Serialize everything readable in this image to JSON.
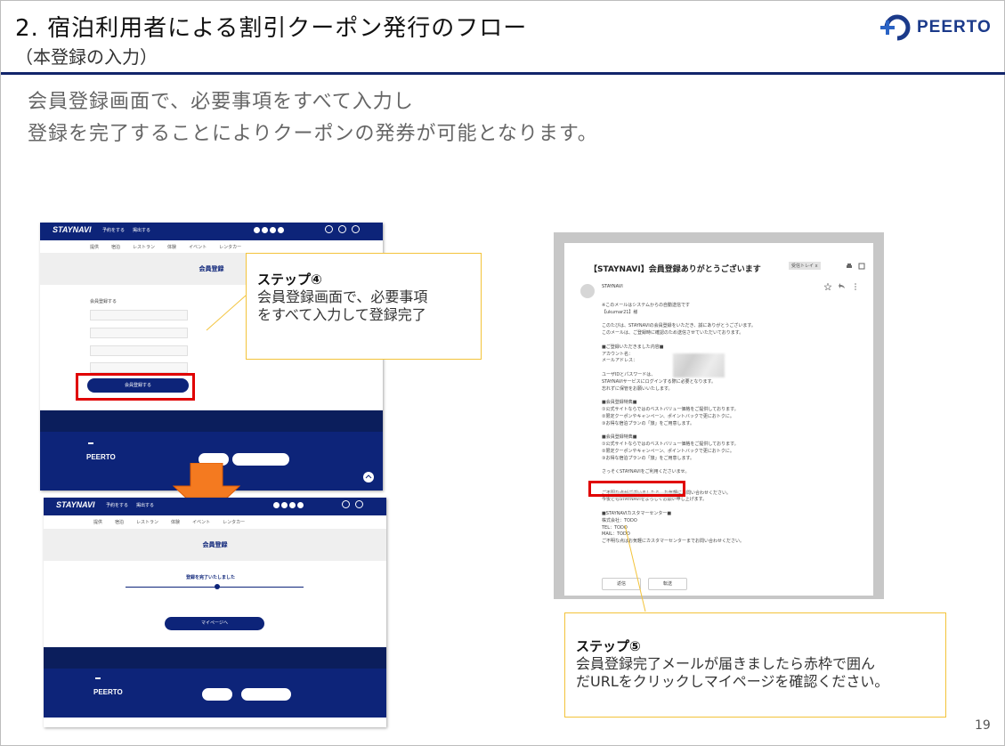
{
  "slide": {
    "title": "2. 宿泊利用者による割引クーポン発行のフロー",
    "subtitle": "（本登録の入力）",
    "brand": "PEERTO",
    "lead_lines": [
      "会員登録画面で、必要事項をすべて入力し",
      "登録を完了することによりクーポンの発券が可能となります。"
    ],
    "page_number": "19",
    "accent_color": "#12256b",
    "highlight_color": "#e00000",
    "callout_border": "#f3c33a"
  },
  "step4": {
    "label": "ステップ④",
    "lines": [
      "会員登録画面で、必要事項",
      "をすべて入力して登録完了"
    ]
  },
  "step5": {
    "label": "ステップ⑤",
    "lines": [
      "会員登録完了メールが届きましたら赤枠で囲ん",
      "だURLをクリックしマイページを確認ください。"
    ]
  },
  "shot1": {
    "logo": "STAYNAVI",
    "header_buttons": [
      "予約をする",
      "掲出する"
    ],
    "nav": [
      "提供",
      "宿泊",
      "レストラン",
      "体験",
      "イベント",
      "レンタカー"
    ],
    "banner": "会員登録",
    "form_heading": "会員登録する",
    "fields": [
      "",
      "",
      "",
      ""
    ],
    "submit": "会員登録する",
    "footer_logo": "PEERTO"
  },
  "shot2": {
    "logo": "STAYNAVI",
    "header_buttons": [
      "予約をする",
      "掲出する"
    ],
    "nav": [
      "提供",
      "宿泊",
      "レストラン",
      "体験",
      "イベント",
      "レンタカー"
    ],
    "banner": "会員登録",
    "done_heading": "登録を完了いたしました",
    "mypage": "マイページへ",
    "footer_logo": "PEERTO"
  },
  "email": {
    "subject": "【STAYNAVI】会員登録ありがとうございます",
    "tag": "受信トレイ x",
    "sender": "STAYNAVI",
    "reply": "返信",
    "forward": "転送",
    "body_lines": [
      "※このメールはシステムからの自動送信です",
      "【ukumar21】様",
      "",
      "このたびは、STAYNAVIの会員登録をいただき、誠にありがとうございます。",
      "このメールは、ご登録時に確認のため送信させていただいております。",
      "",
      "■ご登録いただきました内容■",
      "アカウント名：",
      "メールアドレス：",
      "",
      "ユーザIDとパスワードは、",
      "STAYNAVIサービスにログインする際に必要となります。",
      "忘れずに保管をお願いいたします。",
      "",
      "■会員登録特典■",
      "①公式サイトならではのベストバリュー価格をご提供しております。",
      "②限定クーポンやキャンペーン、ポイントバックで更におトクに。",
      "③お得な宿泊プランの「旅」をご用意します。",
      "",
      "■会員登録特典■",
      "①公式サイトならではのベストバリュー価格をご提供しております。",
      "②限定クーポンやキャンペーン、ポイントバックで更におトクに。",
      "③お得な宿泊プランの「旅」をご用意します。",
      "",
      "さっそくSTAYNAVIをご利用くださいませ。",
      "",
      "",
      "ご不明な点がございましたら、お気軽にお問い合わせください。",
      "今後ともSTAYNAVIをよろしくお願い申し上げます。",
      "",
      "■STAYNAVIカスタマーセンター■",
      "株式会社：TODO",
      "TEL：TODO",
      "MAIL：TODO",
      "ご不明な点はお気軽にカスタマーセンターまでお問い合わせください。"
    ]
  }
}
